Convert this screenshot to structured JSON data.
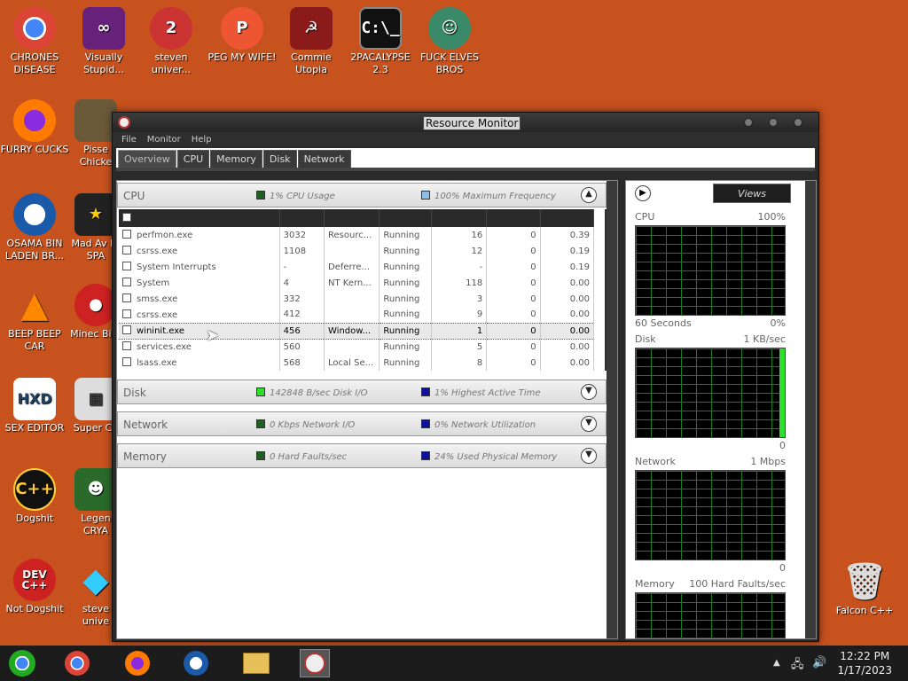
{
  "desktop": {
    "icons": [
      {
        "label": "CHRONES DISEASE"
      },
      {
        "label": "Visually Stupid..."
      },
      {
        "label": "steven univer..."
      },
      {
        "label": "PEG MY WIFE!"
      },
      {
        "label": "Commie Utopia"
      },
      {
        "label": "2PACALYPSE 2.3"
      },
      {
        "label": "FUCK ELVES BROS"
      },
      {
        "label": "FURRY CUCKS"
      },
      {
        "label": "Pisse Chicke"
      },
      {
        "label": "OSAMA BIN LADEN BR..."
      },
      {
        "label": "Mad Av IN SPA"
      },
      {
        "label": "BEEP BEEP CAR"
      },
      {
        "label": "Minec Bird"
      },
      {
        "label": "SEX EDITOR"
      },
      {
        "label": "Super Ch"
      },
      {
        "label": "Dogshit"
      },
      {
        "label": "Legen CRYA"
      },
      {
        "label": "Not Dogshit"
      },
      {
        "label": "steve unive"
      },
      {
        "label": "Falcon C++"
      }
    ]
  },
  "window": {
    "title": "Resource Monitor",
    "menu": [
      "File",
      "Monitor",
      "Help"
    ],
    "tabs": [
      "Overview",
      "CPU",
      "Memory",
      "Disk",
      "Network"
    ],
    "active_tab": "Overview"
  },
  "cpu_section": {
    "name": "CPU",
    "metric1": "1% CPU Usage",
    "metric2": "100% Maximum Frequency",
    "metric1_color": "#1f5f1f",
    "metric2_color": "#8fbfe8"
  },
  "processes": [
    {
      "image": "perfmon.exe",
      "pid": "3032",
      "desc": "Resourc...",
      "status": "Running",
      "threads": "16",
      "cpu": "0",
      "avg": "0.39"
    },
    {
      "image": "csrss.exe",
      "pid": "1108",
      "desc": "",
      "status": "Running",
      "threads": "12",
      "cpu": "0",
      "avg": "0.19"
    },
    {
      "image": "System Interrupts",
      "pid": "-",
      "desc": "Deferre...",
      "status": "Running",
      "threads": "-",
      "cpu": "0",
      "avg": "0.19"
    },
    {
      "image": "System",
      "pid": "4",
      "desc": "NT Kern...",
      "status": "Running",
      "threads": "118",
      "cpu": "0",
      "avg": "0.00"
    },
    {
      "image": "smss.exe",
      "pid": "332",
      "desc": "",
      "status": "Running",
      "threads": "3",
      "cpu": "0",
      "avg": "0.00"
    },
    {
      "image": "csrss.exe",
      "pid": "412",
      "desc": "",
      "status": "Running",
      "threads": "9",
      "cpu": "0",
      "avg": "0.00"
    },
    {
      "image": "wininit.exe",
      "pid": "456",
      "desc": "Window...",
      "status": "Running",
      "threads": "1",
      "cpu": "0",
      "avg": "0.00",
      "selected": true
    },
    {
      "image": "services.exe",
      "pid": "560",
      "desc": "",
      "status": "Running",
      "threads": "5",
      "cpu": "0",
      "avg": "0.00"
    },
    {
      "image": "lsass.exe",
      "pid": "568",
      "desc": "Local Se...",
      "status": "Running",
      "threads": "8",
      "cpu": "0",
      "avg": "0.00"
    }
  ],
  "disk_section": {
    "name": "Disk",
    "metric1": "142848 B/sec Disk I/O",
    "metric2": "1% Highest Active Time",
    "metric1_color": "#2ee02e",
    "metric2_color": "#1010a0"
  },
  "network_section": {
    "name": "Network",
    "metric1": "0 Kbps Network I/O",
    "metric2": "0% Network Utilization",
    "metric1_color": "#1f5f1f",
    "metric2_color": "#1010a0"
  },
  "memory_section": {
    "name": "Memory",
    "metric1": "0 Hard Faults/sec",
    "metric2": "24% Used Physical Memory",
    "metric1_color": "#1f5f1f",
    "metric2_color": "#1010a0"
  },
  "right_pane": {
    "views_label": "Views",
    "graphs": [
      {
        "name": "CPU",
        "max": "100%",
        "foot_left": "60 Seconds",
        "foot_right": "0%"
      },
      {
        "name": "Disk",
        "max": "1 KB/sec",
        "foot_left": "",
        "foot_right": "0"
      },
      {
        "name": "Network",
        "max": "1 Mbps",
        "foot_left": "",
        "foot_right": "0"
      },
      {
        "name": "Memory",
        "max": "100 Hard Faults/sec",
        "foot_left": "",
        "foot_right": ""
      }
    ]
  },
  "taskbar": {
    "time": "12:22 PM",
    "date": "1/17/2023"
  }
}
